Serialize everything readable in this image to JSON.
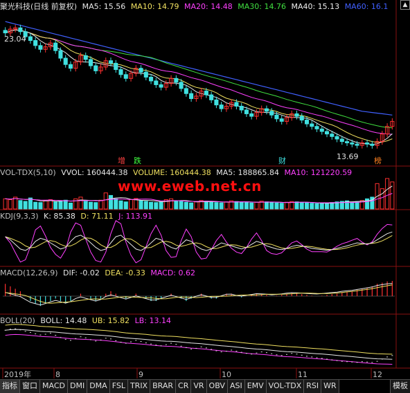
{
  "title": "聚光科技(日线 前复权)",
  "colors": {
    "ma5": "#e8e8e8",
    "ma10": "#f0e060",
    "ma20": "#ff40ff",
    "ma30": "#40e040",
    "ma40": "#f0f0f0",
    "ma60": "#4060ff",
    "up": "#ff3030",
    "down": "#40e0e0",
    "kline_ref": "#f0f0a0"
  },
  "main_indicators": [
    {
      "label": "MA5: 15.56",
      "color": "#e8e8e8"
    },
    {
      "label": "MA10: 14.79",
      "color": "#f0e060"
    },
    {
      "label": "MA20: 14.48",
      "color": "#ff40ff"
    },
    {
      "label": "MA30: 14.76",
      "color": "#40e040"
    },
    {
      "label": "MA40: 15.13",
      "color": "#f0f0f0"
    },
    {
      "label": "MA60: 16.1",
      "color": "#4060ff"
    }
  ],
  "vol_indicators": [
    {
      "label": "VOL-TDX(5,10)",
      "color": "#c0c0c0"
    },
    {
      "label": "VVOL: 160444.38",
      "color": "#e8e8e8"
    },
    {
      "label": "VOLUME: 160444.38",
      "color": "#f0e060"
    },
    {
      "label": "MA5: 188865.84",
      "color": "#e8e8e8"
    },
    {
      "label": "MA10: 121220.59",
      "color": "#ff40ff"
    }
  ],
  "kdj_indicators": [
    {
      "label": "KDJ(9,3,3)",
      "color": "#c0c0c0"
    },
    {
      "label": "K: 85.38",
      "color": "#e8e8e8"
    },
    {
      "label": "D: 71.11",
      "color": "#f0e060"
    },
    {
      "label": "J: 113.91",
      "color": "#ff40ff"
    }
  ],
  "macd_indicators": [
    {
      "label": "MACD(12,26,9)",
      "color": "#c0c0c0"
    },
    {
      "label": "DIF: -0.02",
      "color": "#e8e8e8"
    },
    {
      "label": "DEA: -0.33",
      "color": "#f0e060"
    },
    {
      "label": "MACD: 0.62",
      "color": "#ff40ff"
    }
  ],
  "boll_indicators": [
    {
      "label": "BOLL(20)",
      "color": "#c0c0c0"
    },
    {
      "label": "BOLL: 14.48",
      "color": "#e8e8e8"
    },
    {
      "label": "UB: 15.82",
      "color": "#f0e060"
    },
    {
      "label": "LB: 13.14",
      "color": "#ff40ff"
    }
  ],
  "annotations": {
    "high_price": "23.04",
    "low_price": "13.69",
    "marker_zeng": "增",
    "marker_die": "跌",
    "marker_cai": "财",
    "marker_bang": "榜"
  },
  "watermark": "www.eweb.net.cn",
  "x_axis": {
    "labels": [
      "2019年",
      "8",
      "9",
      "10",
      "11",
      "12"
    ]
  },
  "bottom_tabs": [
    "指标",
    "窗口",
    "MACD",
    "DMI",
    "DMA",
    "FSL",
    "TRIX",
    "BRAR",
    "CR",
    "VR",
    "OBV",
    "ASI",
    "EMV",
    "VOL-TDX",
    "RSI",
    "WR"
  ],
  "bottom_right": "模板",
  "chart_data": {
    "type": "line",
    "price_range": [
      12.5,
      24.0
    ],
    "close": [
      22.6,
      22.9,
      23.0,
      22.7,
      22.3,
      22.0,
      21.6,
      21.3,
      21.5,
      21.8,
      21.2,
      20.6,
      20.1,
      19.8,
      20.3,
      20.8,
      20.5,
      20.0,
      19.6,
      19.9,
      20.4,
      20.2,
      19.7,
      19.3,
      19.0,
      19.4,
      19.8,
      19.5,
      19.1,
      18.8,
      18.5,
      18.3,
      18.6,
      19.0,
      18.7,
      18.2,
      17.8,
      17.4,
      17.6,
      18.0,
      17.7,
      17.3,
      16.9,
      16.6,
      16.8,
      17.1,
      16.8,
      16.5,
      16.2,
      16.0,
      16.3,
      16.6,
      16.4,
      16.1,
      15.8,
      15.6,
      15.9,
      16.2,
      16.0,
      15.7,
      15.4,
      15.2,
      15.0,
      14.8,
      14.6,
      14.4,
      14.2,
      14.0,
      13.9,
      13.8,
      13.7,
      13.9,
      13.8,
      13.69,
      14.0,
      14.6,
      15.2,
      15.6
    ],
    "ma60": [
      23.5,
      23.4,
      23.3,
      23.2,
      23.1,
      23.0,
      22.9,
      22.8,
      22.7,
      22.6,
      22.5,
      22.4,
      22.3,
      22.2,
      22.1,
      22.0,
      21.9,
      21.8,
      21.7,
      21.6,
      21.5,
      21.4,
      21.3,
      21.2,
      21.1,
      21.0,
      20.9,
      20.8,
      20.7,
      20.6,
      20.5,
      20.4,
      20.3,
      20.2,
      20.1,
      20.0,
      19.9,
      19.8,
      19.7,
      19.6,
      19.5,
      19.4,
      19.3,
      19.2,
      19.1,
      19.0,
      18.9,
      18.8,
      18.7,
      18.6,
      18.5,
      18.4,
      18.3,
      18.2,
      18.1,
      18.0,
      17.9,
      17.8,
      17.7,
      17.6,
      17.5,
      17.4,
      17.3,
      17.2,
      17.1,
      17.0,
      16.9,
      16.8,
      16.7,
      16.6,
      16.5,
      16.4,
      16.35,
      16.3,
      16.25,
      16.2,
      16.15,
      16.1
    ],
    "volume": [
      60,
      55,
      70,
      50,
      45,
      65,
      40,
      38,
      50,
      55,
      42,
      48,
      52,
      35,
      60,
      70,
      45,
      40,
      38,
      52,
      95,
      80,
      60,
      48,
      42,
      55,
      62,
      50,
      45,
      40,
      38,
      42,
      55,
      60,
      48,
      45,
      40,
      36,
      42,
      50,
      46,
      40,
      38,
      36,
      42,
      48,
      44,
      40,
      38,
      36,
      40,
      46,
      42,
      38,
      36,
      34,
      40,
      44,
      42,
      38,
      36,
      34,
      32,
      34,
      36,
      38,
      42,
      45,
      48,
      40,
      44,
      50,
      60,
      70,
      150,
      120,
      180,
      160
    ],
    "kdj_k": [
      70,
      60,
      45,
      30,
      25,
      35,
      55,
      65,
      60,
      50,
      40,
      30,
      35,
      55,
      70,
      75,
      65,
      50,
      35,
      25,
      30,
      50,
      70,
      75,
      60,
      45,
      30,
      25,
      35,
      50,
      65,
      60,
      45,
      35,
      30,
      45,
      60,
      55,
      40,
      30,
      25,
      30,
      40,
      50,
      45,
      40,
      35,
      30,
      35,
      45,
      55,
      50,
      40,
      35,
      30,
      28,
      32,
      38,
      42,
      40,
      36,
      32,
      30,
      28,
      26,
      28,
      32,
      36,
      40,
      45,
      50,
      48,
      46,
      50,
      60,
      70,
      80,
      85.38
    ],
    "macd_hist": [
      0.5,
      0.4,
      0.3,
      0.2,
      0.0,
      -0.2,
      -0.3,
      -0.4,
      -0.3,
      -0.2,
      -0.1,
      -0.2,
      -0.3,
      -0.2,
      0.0,
      0.1,
      0.0,
      -0.1,
      -0.2,
      -0.1,
      0.1,
      0.2,
      0.1,
      0.0,
      -0.1,
      0.0,
      0.1,
      0.0,
      -0.1,
      -0.2,
      -0.2,
      -0.1,
      0.0,
      0.1,
      0.0,
      -0.1,
      -0.2,
      -0.1,
      0.0,
      0.1,
      0.0,
      -0.1,
      -0.1,
      0.0,
      0.1,
      0.1,
      0.0,
      -0.05,
      0.0,
      0.05,
      0.1,
      0.08,
      0.05,
      0.0,
      0.02,
      0.05,
      0.1,
      0.12,
      0.1,
      0.08,
      0.05,
      0.02,
      0.0,
      0.02,
      0.05,
      0.08,
      0.1,
      0.15,
      0.18,
      0.2,
      0.25,
      0.3,
      0.35,
      0.4,
      0.5,
      0.55,
      0.6,
      0.62
    ]
  }
}
